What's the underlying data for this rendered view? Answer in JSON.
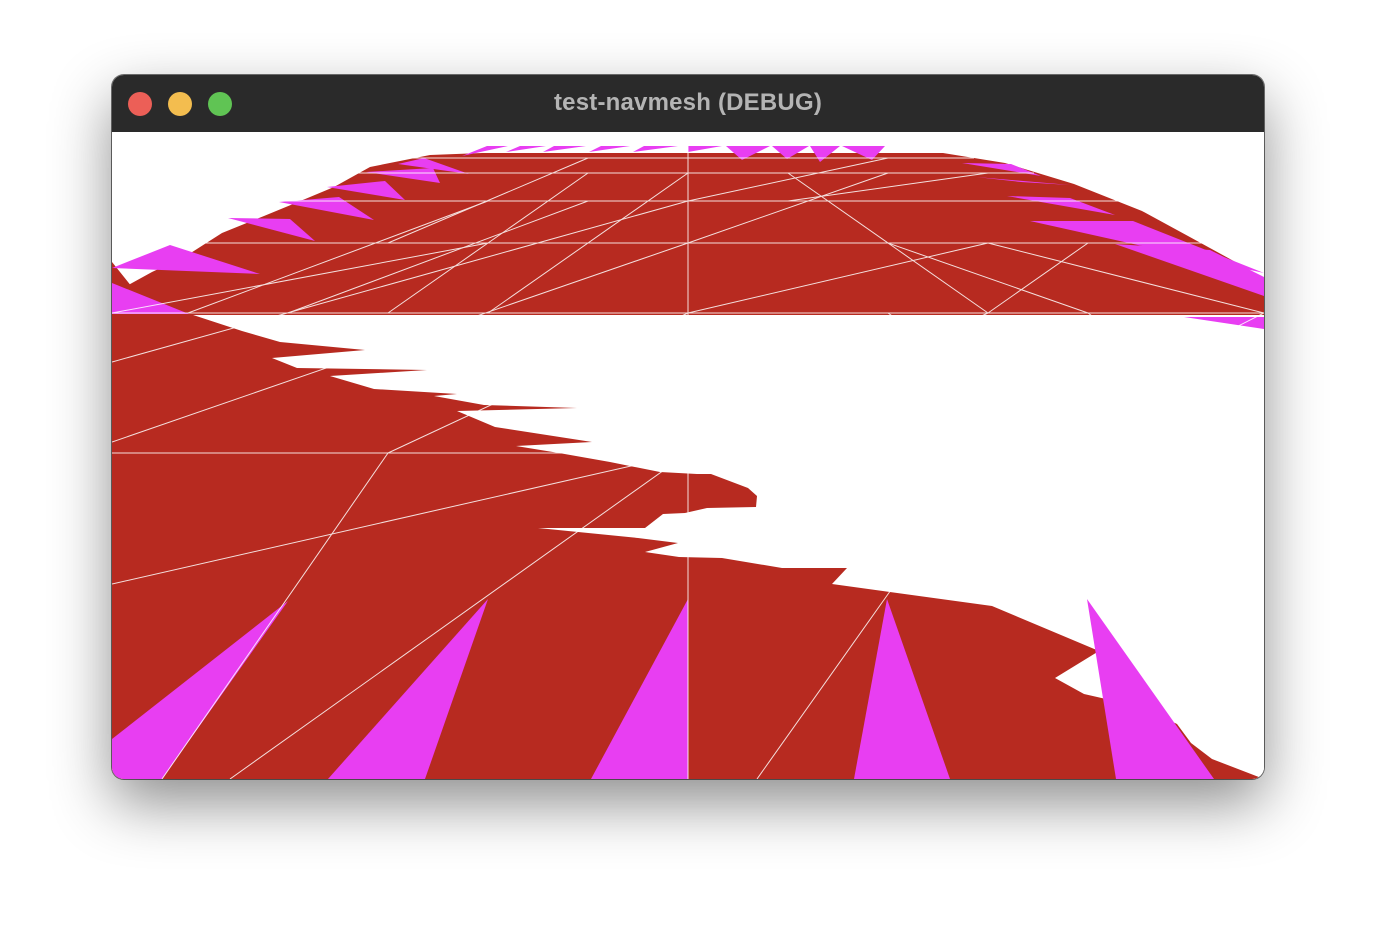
{
  "window": {
    "title": "test-navmesh (DEBUG)",
    "controls": [
      {
        "name": "close",
        "color": "#ec5f57"
      },
      {
        "name": "minimize",
        "color": "#f3bd4f"
      },
      {
        "name": "zoom",
        "color": "#60c454"
      }
    ]
  },
  "scene": {
    "background": "#ffffff",
    "mesh_fill": "#b72a20",
    "spike_fill": "#e83ef2",
    "edge_color": "#ffffff"
  }
}
